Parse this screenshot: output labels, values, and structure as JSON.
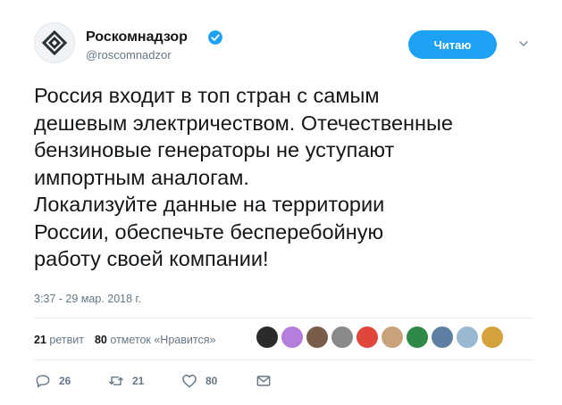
{
  "account": {
    "display_name": "Роскомнадзор",
    "handle": "@roscomnadzor",
    "verified_icon": "verified-badge-icon",
    "accent": "#1da1f2"
  },
  "follow_button": {
    "label": "Читаю"
  },
  "tweet": {
    "lines": [
      "Россия входит в топ стран с самым",
      "дешевым электричеством. Отечественные",
      "бензиновые генераторы не уступают",
      "импортным аналогам.",
      "Локализуйте данные на территории",
      "России, обеспечьте бесперебойную",
      "работу своей компании!"
    ],
    "timestamp": "3:37 - 29 мар. 2018 г."
  },
  "stats": {
    "retweets_count": "21",
    "retweets_label": "ретвит",
    "likes_count": "80",
    "likes_label": "отметок «Нравится»"
  },
  "likers_colors": [
    "#2b2b2b",
    "#b57edc",
    "#7a5c4a",
    "#8a8a8a",
    "#e0463c",
    "#c9a27c",
    "#2f8a4a",
    "#5c7fa3",
    "#9ab8d1",
    "#d4a23c"
  ],
  "actions": {
    "reply_count": "26",
    "retweet_count": "21",
    "like_count": "80"
  }
}
